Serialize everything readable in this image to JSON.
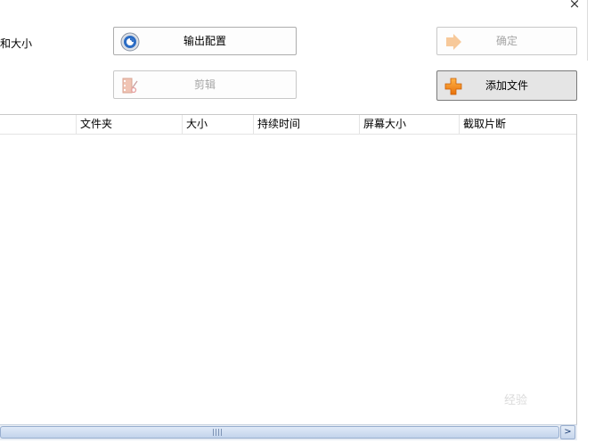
{
  "window": {
    "close_glyph": "×"
  },
  "left_label": "和大小",
  "buttons": {
    "output_config": {
      "label": "输出配置",
      "icon": "gear-disc-icon"
    },
    "confirm": {
      "label": "确定",
      "icon": "arrow-right-icon",
      "disabled": true
    },
    "edit": {
      "label": "剪辑",
      "icon": "film-scissors-icon",
      "disabled": true
    },
    "add_file": {
      "label": "添加文件",
      "icon": "plus-icon"
    }
  },
  "table": {
    "columns": [
      "文件夹",
      "大小",
      "持续时间",
      "屏幕大小",
      "截取片断"
    ],
    "rows": []
  },
  "scrollbar": {
    "right_arrow": ">"
  },
  "watermark": "经验"
}
